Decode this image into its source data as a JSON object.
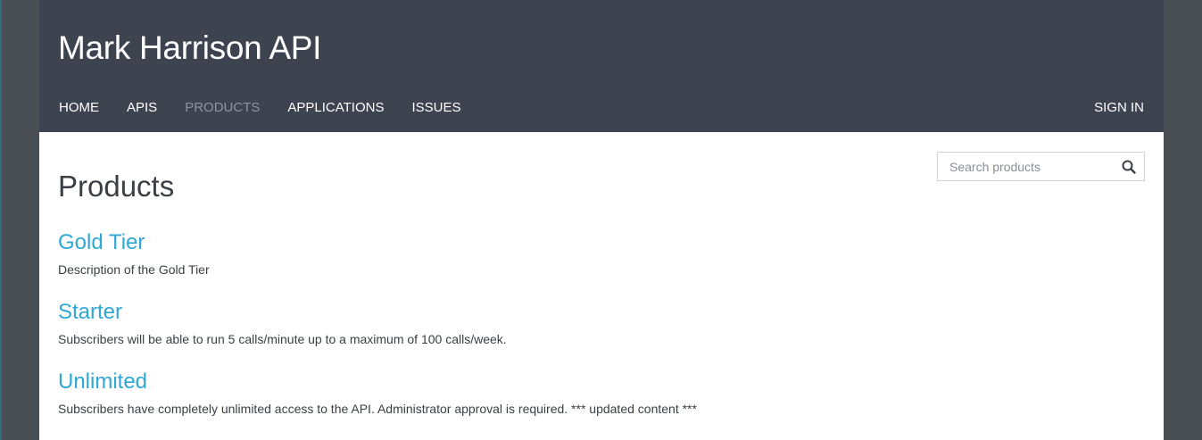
{
  "header": {
    "site_title": "Mark Harrison API",
    "nav": [
      {
        "label": "HOME"
      },
      {
        "label": "APIS"
      },
      {
        "label": "PRODUCTS"
      },
      {
        "label": "APPLICATIONS"
      },
      {
        "label": "ISSUES"
      }
    ],
    "active_nav": "PRODUCTS",
    "sign_in_label": "SIGN IN"
  },
  "main": {
    "page_title": "Products",
    "search": {
      "placeholder": "Search products",
      "value": "",
      "icon": "search-icon"
    },
    "products": [
      {
        "name": "Gold Tier",
        "description": "Description of the Gold Tier"
      },
      {
        "name": "Starter",
        "description": "Subscribers will be able to run 5 calls/minute up to a maximum of 100 calls/week."
      },
      {
        "name": "Unlimited",
        "description": "Subscribers have completely unlimited access to the API. Administrator approval is required. *** updated content ***"
      }
    ]
  },
  "colors": {
    "header_bg": "#3d4450",
    "link": "#2fa8d6",
    "nav_active": "#8e949c",
    "text": "#3b3f45"
  }
}
